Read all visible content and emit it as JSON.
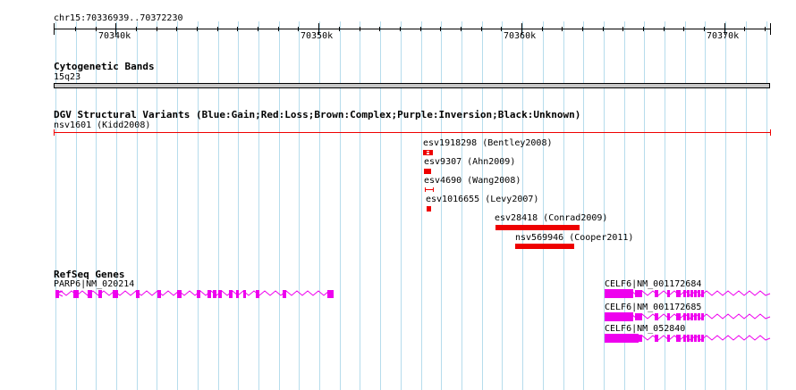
{
  "ruler": {
    "location": "chr15:70336939..70372230",
    "ticks": [
      "70340k",
      "70350k",
      "70360k",
      "70370k"
    ]
  },
  "tracks": {
    "cytoband": {
      "title": "Cytogenetic Bands",
      "band_label": "15q23"
    },
    "dgv": {
      "title": "DGV Structural Variants (Blue:Gain;Red:Loss;Brown:Complex;Purple:Inversion;Black:Unknown)",
      "features": [
        {
          "label": "nsv1601 (Kidd2008)"
        },
        {
          "label": "esv1918298 (Bentley2008)"
        },
        {
          "label": "esv9307 (Ahn2009)"
        },
        {
          "label": "esv4690 (Wang2008)"
        },
        {
          "label": "esv1016655 (Levy2007)"
        },
        {
          "label": "esv28418 (Conrad2009)"
        },
        {
          "label": "nsv569946 (Cooper2011)"
        }
      ]
    },
    "refseq": {
      "title": "RefSeq Genes",
      "genes": [
        {
          "label": "PARP6|NM_020214"
        },
        {
          "label": "CELF6|NM_001172684"
        },
        {
          "label": "CELF6|NM_001172685"
        },
        {
          "label": "CELF6|NM_052840"
        }
      ]
    }
  },
  "colors": {
    "grid": "#b6dcec",
    "loss": "#ee0000",
    "gene": "#ee00ee",
    "band": "#c8c8c8"
  }
}
